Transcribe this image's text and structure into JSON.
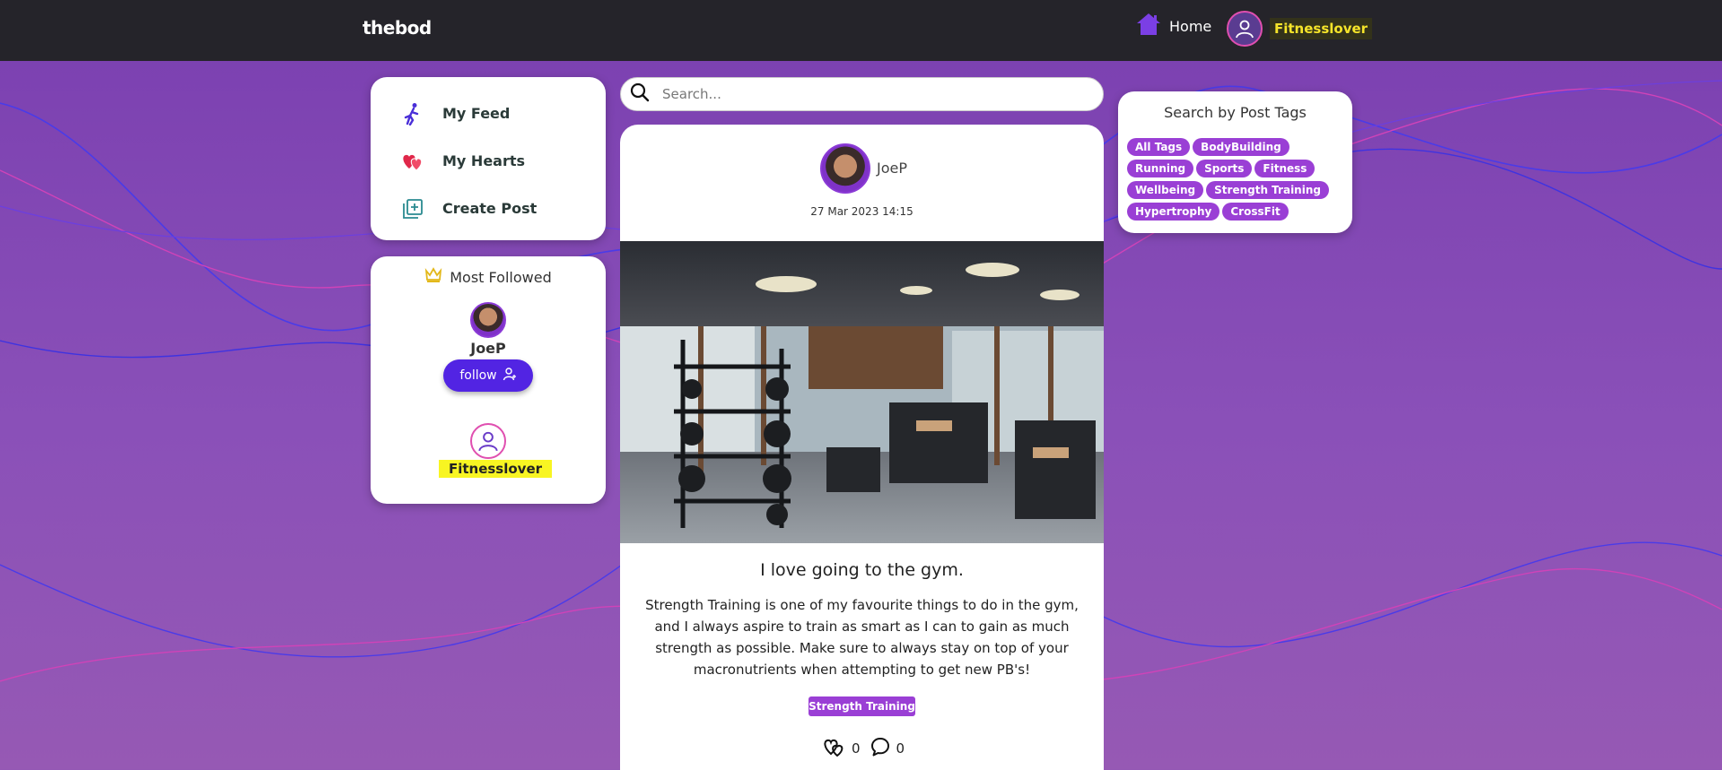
{
  "navbar": {
    "brand": "thebod",
    "home_label": "Home",
    "username": "Fitnesslover"
  },
  "menu": {
    "items": [
      {
        "label": "My Feed",
        "icon": "runner-icon"
      },
      {
        "label": "My Hearts",
        "icon": "hearts-icon"
      },
      {
        "label": "Create Post",
        "icon": "add-post-icon"
      }
    ]
  },
  "most_followed": {
    "title": "Most Followed",
    "users": [
      {
        "name": "JoeP",
        "follow_label": "follow"
      },
      {
        "name": "Fitnesslover"
      }
    ]
  },
  "search": {
    "placeholder": "Search..."
  },
  "post": {
    "author": "JoeP",
    "date": "27 Mar 2023 14:15",
    "title": "I love going to the gym.",
    "body": "Strength Training is one of my favourite things to do in the gym, and I always aspire to train as smart as I can to gain as much strength as possible. Make sure to always stay on top of your macronutrients when attempting to get new PB's!",
    "tag": "Strength Training",
    "hearts": "0",
    "comments": "0"
  },
  "tag_search": {
    "title": "Search by Post Tags",
    "tags": [
      "All Tags",
      "BodyBuilding",
      "Running",
      "Sports",
      "Fitness",
      "Wellbeing",
      "Strength Training",
      "Hypertrophy",
      "CrossFit"
    ]
  },
  "colors": {
    "navbar": "#25242a",
    "accent_purple": "#9a3fd5",
    "follow_button": "#5224e3",
    "username_highlight": "#f5e42a"
  }
}
